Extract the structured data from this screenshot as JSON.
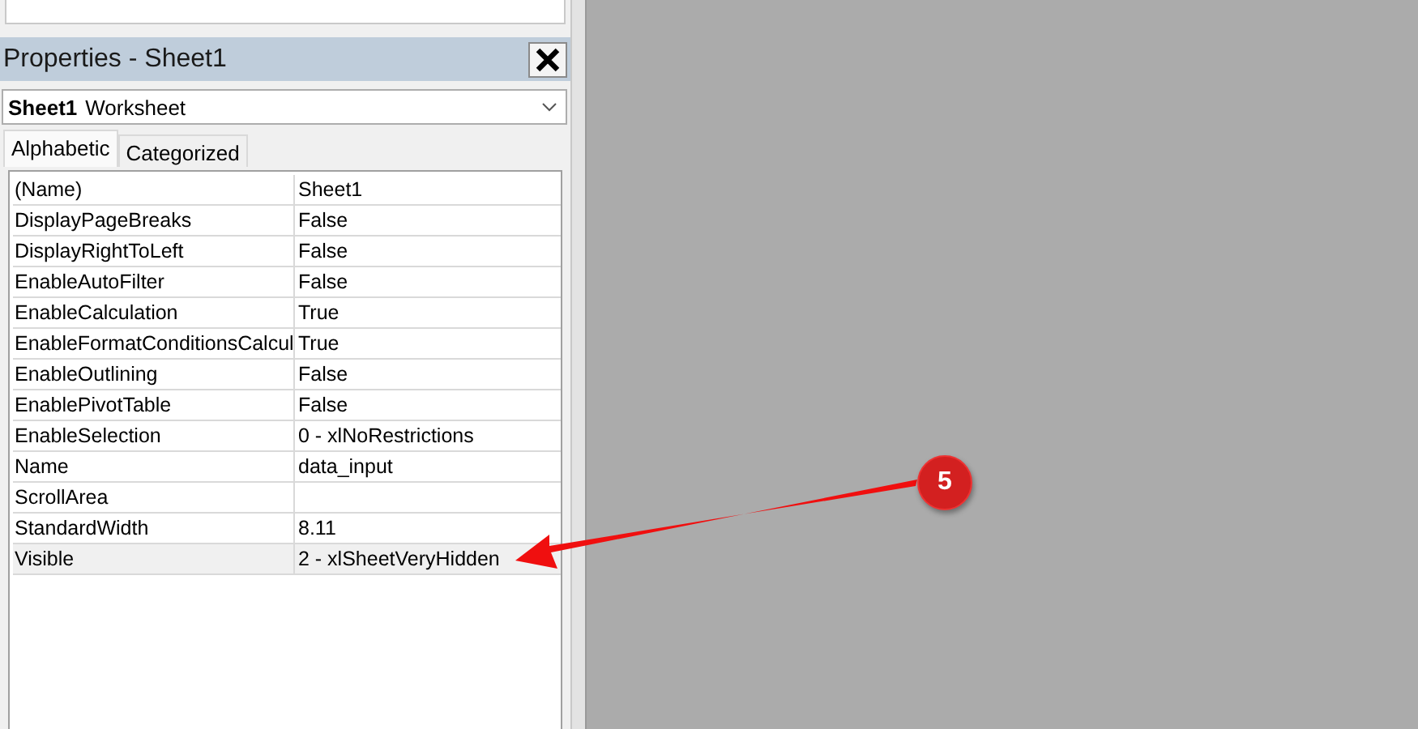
{
  "panel": {
    "title": "Properties - Sheet1"
  },
  "object_selector": {
    "name": "Sheet1",
    "type": "Worksheet"
  },
  "tabs": [
    {
      "label": "Alphabetic",
      "selected": true
    },
    {
      "label": "Categorized",
      "selected": false
    }
  ],
  "properties": [
    {
      "name": "(Name)",
      "value": "Sheet1",
      "selected": false
    },
    {
      "name": "DisplayPageBreaks",
      "value": "False",
      "selected": false
    },
    {
      "name": "DisplayRightToLeft",
      "value": "False",
      "selected": false
    },
    {
      "name": "EnableAutoFilter",
      "value": "False",
      "selected": false
    },
    {
      "name": "EnableCalculation",
      "value": "True",
      "selected": false
    },
    {
      "name": "EnableFormatConditionsCalcul",
      "value": "True",
      "selected": false
    },
    {
      "name": "EnableOutlining",
      "value": "False",
      "selected": false
    },
    {
      "name": "EnablePivotTable",
      "value": "False",
      "selected": false
    },
    {
      "name": "EnableSelection",
      "value": "0 - xlNoRestrictions",
      "selected": false
    },
    {
      "name": "Name",
      "value": "data_input",
      "selected": false
    },
    {
      "name": "ScrollArea",
      "selected": false
    },
    {
      "name": "StandardWidth",
      "value": "8.11",
      "selected": false
    },
    {
      "name": "Visible",
      "value": "2 - xlSheetVeryHidden",
      "selected": true
    }
  ],
  "callout": {
    "label": "5"
  }
}
